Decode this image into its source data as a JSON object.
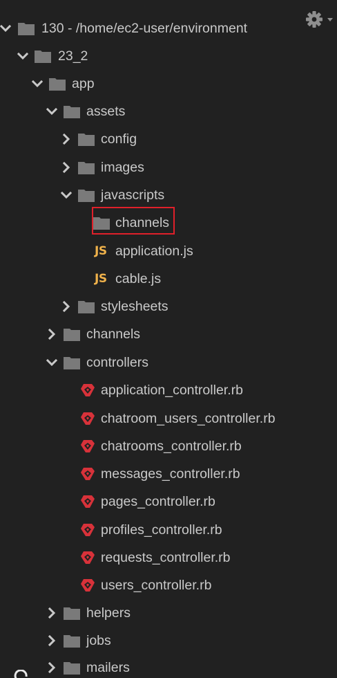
{
  "toolbar": {
    "settings_icon": "gear-icon"
  },
  "colors": {
    "background": "#212121",
    "text": "#c9c9c9",
    "folder": "#7a7a7a",
    "arrow": "#c9c9c9",
    "js_icon": "#f0b24b",
    "ruby_icon": "#d8323a",
    "highlight_border": "#e0202a"
  },
  "tree": {
    "root": {
      "name": "130",
      "separator": " - ",
      "path": "/home/ec2-user/environment"
    },
    "items": [
      {
        "label": "23_2",
        "type": "folder",
        "expanded": true
      },
      {
        "label": "app",
        "type": "folder",
        "expanded": true
      },
      {
        "label": "assets",
        "type": "folder",
        "expanded": true
      },
      {
        "label": "config",
        "type": "folder",
        "expanded": false
      },
      {
        "label": "images",
        "type": "folder",
        "expanded": false
      },
      {
        "label": "javascripts",
        "type": "folder",
        "expanded": true
      },
      {
        "label": "channels",
        "type": "folder",
        "expanded": null,
        "highlighted": true
      },
      {
        "label": "application.js",
        "type": "js-file",
        "icon_text": "JS"
      },
      {
        "label": "cable.js",
        "type": "js-file",
        "icon_text": "JS"
      },
      {
        "label": "stylesheets",
        "type": "folder",
        "expanded": false
      },
      {
        "label": "channels",
        "type": "folder",
        "expanded": false
      },
      {
        "label": "controllers",
        "type": "folder",
        "expanded": true
      },
      {
        "label": "application_controller.rb",
        "type": "ruby-file"
      },
      {
        "label": "chatroom_users_controller.rb",
        "type": "ruby-file"
      },
      {
        "label": "chatrooms_controller.rb",
        "type": "ruby-file"
      },
      {
        "label": "messages_controller.rb",
        "type": "ruby-file"
      },
      {
        "label": "pages_controller.rb",
        "type": "ruby-file"
      },
      {
        "label": "profiles_controller.rb",
        "type": "ruby-file"
      },
      {
        "label": "requests_controller.rb",
        "type": "ruby-file"
      },
      {
        "label": "users_controller.rb",
        "type": "ruby-file"
      },
      {
        "label": "helpers",
        "type": "folder",
        "expanded": false
      },
      {
        "label": "jobs",
        "type": "folder",
        "expanded": false
      },
      {
        "label": "mailers",
        "type": "folder",
        "expanded": false
      }
    ]
  }
}
